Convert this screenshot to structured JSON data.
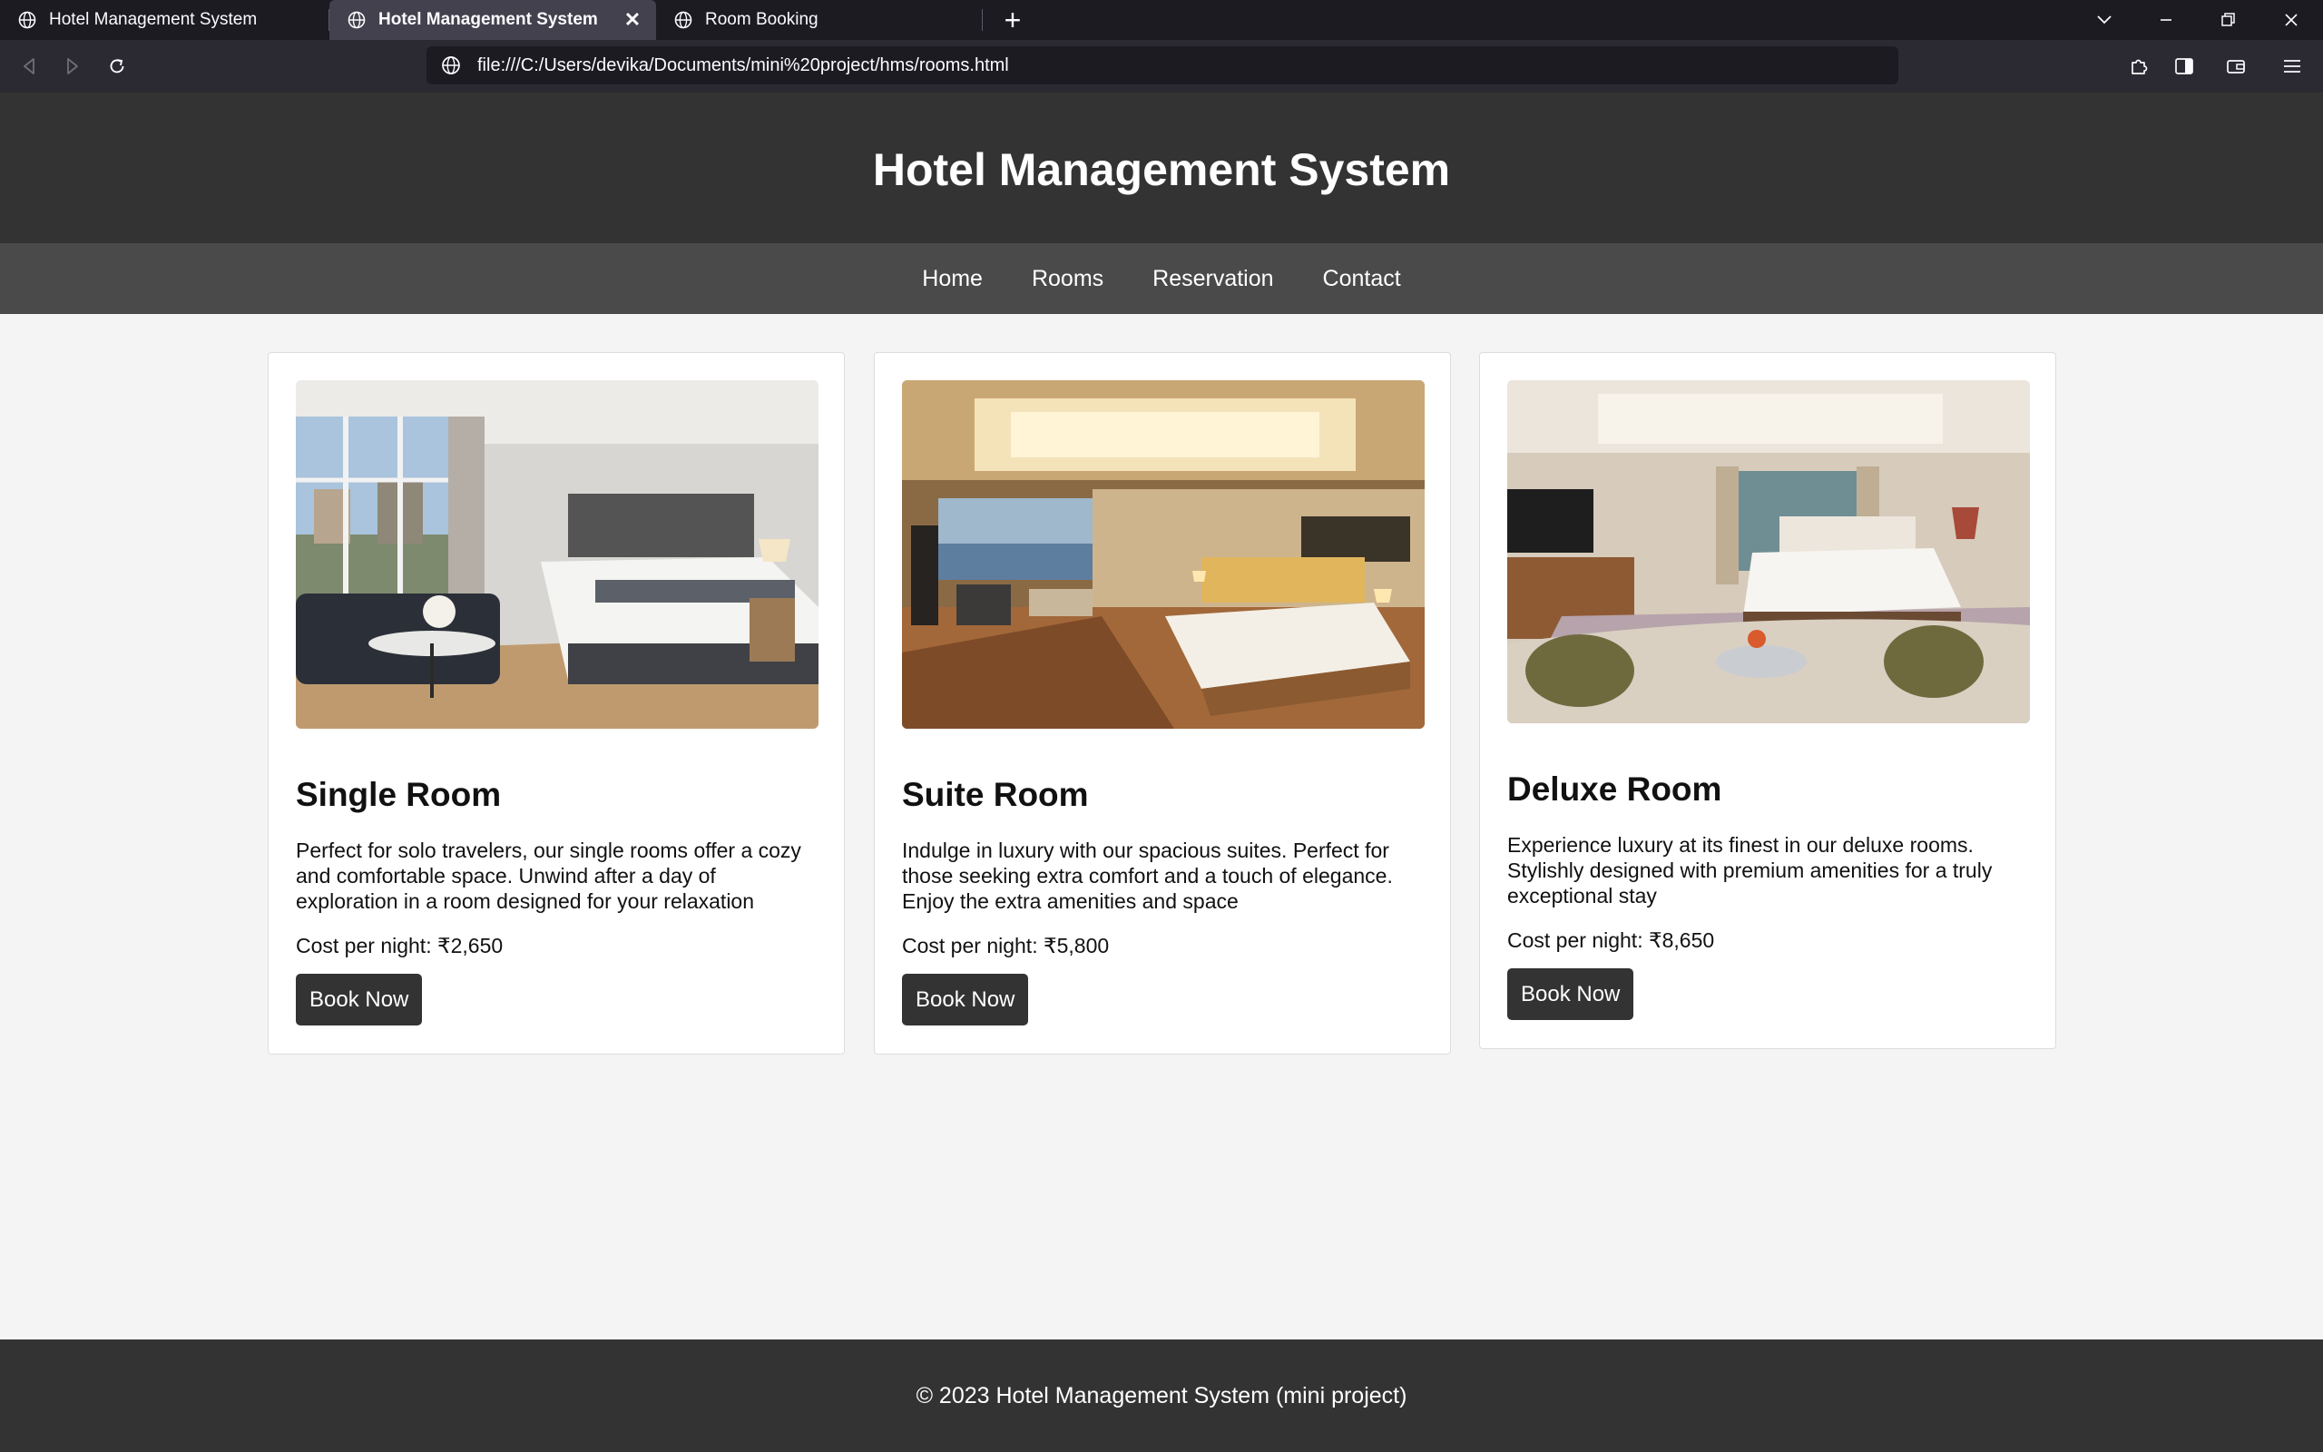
{
  "browser": {
    "tabs": [
      {
        "title": "Hotel Management System",
        "active": false
      },
      {
        "title": "Hotel Management System",
        "active": true
      },
      {
        "title": "Room Booking",
        "active": false
      }
    ],
    "url": "file:///C:/Users/devika/Documents/mini%20project/hms/rooms.html"
  },
  "site": {
    "title": "Hotel Management System",
    "nav": [
      "Home",
      "Rooms",
      "Reservation",
      "Contact"
    ],
    "footer": "© 2023 Hotel Management System (mini project)"
  },
  "rooms": [
    {
      "name": "Single Room",
      "description": "Perfect for solo travelers, our single rooms offer a cozy and comfortable space. Unwind after a day of exploration in a room designed for your relaxation",
      "cost": "Cost per night: ₹2,650",
      "button": "Book Now"
    },
    {
      "name": "Suite Room",
      "description": "Indulge in luxury with our spacious suites. Perfect for those seeking extra comfort and a touch of elegance. Enjoy the extra amenities and space",
      "cost": "Cost per night: ₹5,800",
      "button": "Book Now"
    },
    {
      "name": "Deluxe Room",
      "description": "Experience luxury at its finest in our deluxe rooms. Stylishly designed with premium amenities for a truly exceptional stay",
      "cost": "Cost per night: ₹8,650",
      "button": "Book Now"
    }
  ],
  "colors": {
    "header": "#333333",
    "nav": "#4a4a4a",
    "page_background": "#f4f4f4",
    "button": "#333333"
  }
}
